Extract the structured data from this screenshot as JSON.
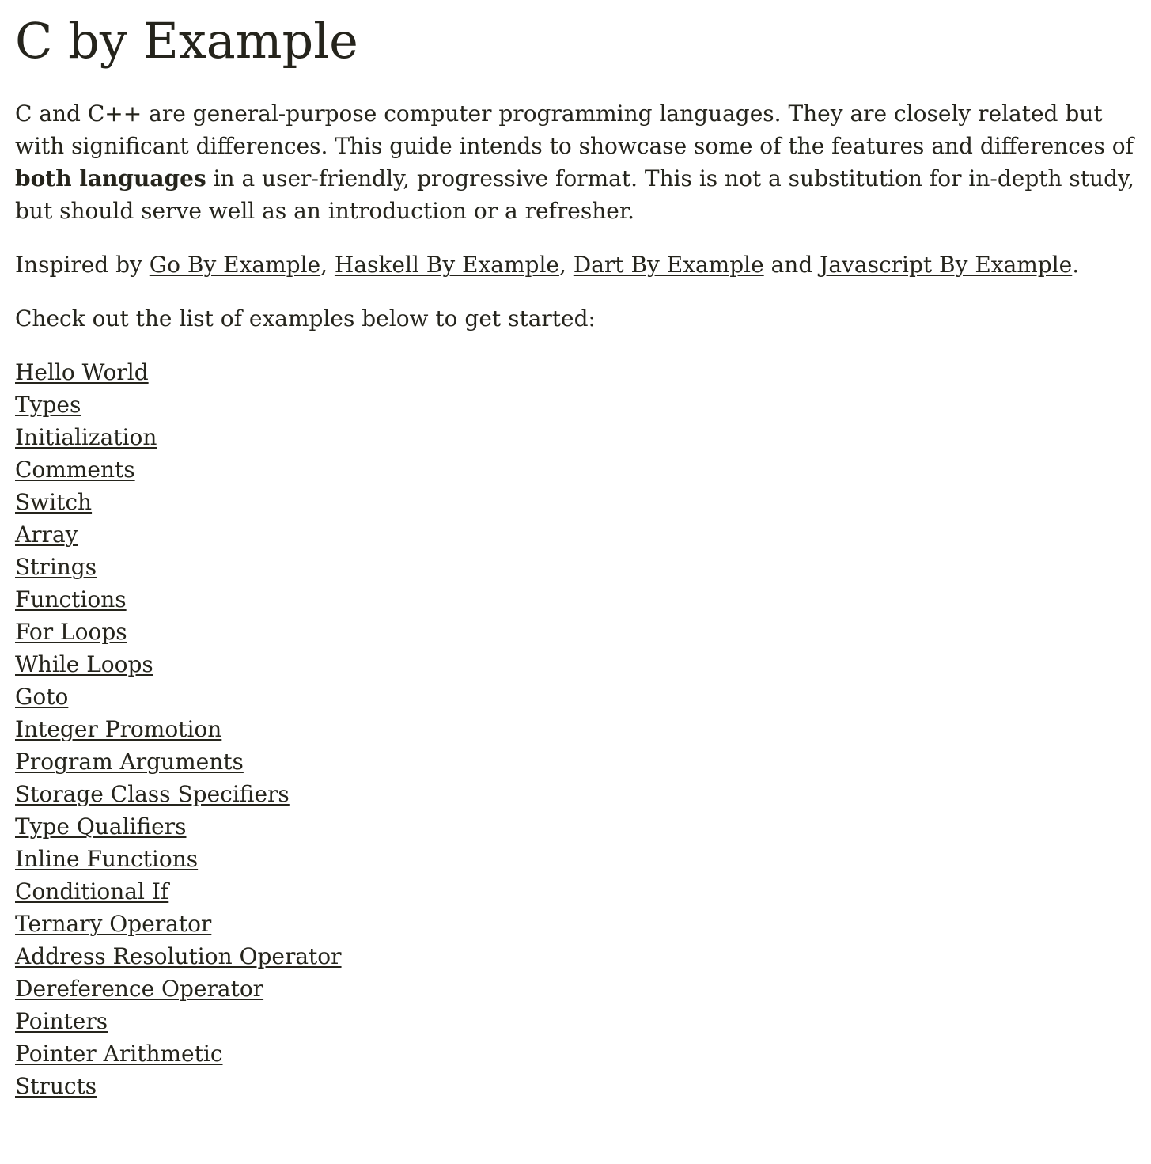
{
  "page": {
    "title": "C by Example",
    "intro": {
      "part1": "C and C++ are general-purpose computer programming languages. They are closely related but with significant differences. This guide intends to showcase some of the features and differences of ",
      "bold": "both languages",
      "part2": " in a user-friendly, progressive format. This is not a substitution for in-depth study, but should serve well as an introduction or a refresher."
    },
    "inspired": {
      "prefix": "Inspired by ",
      "links": [
        "Go By Example",
        "Haskell By Example",
        "Dart By Example",
        "Javascript By Example"
      ],
      "sep1": ", ",
      "sep2": ", ",
      "sep3": " and ",
      "suffix": "."
    },
    "checkout": "Check out the list of examples below to get started:",
    "examples": [
      "Hello World",
      "Types",
      "Initialization",
      "Comments",
      "Switch",
      "Array",
      "Strings",
      "Functions",
      "For Loops",
      "While Loops",
      "Goto",
      "Integer Promotion",
      "Program Arguments",
      "Storage Class Specifiers",
      "Type Qualifiers",
      "Inline Functions",
      "Conditional If",
      "Ternary Operator",
      "Address Resolution Operator",
      "Dereference Operator",
      "Pointers",
      "Pointer Arithmetic",
      "Structs"
    ]
  }
}
